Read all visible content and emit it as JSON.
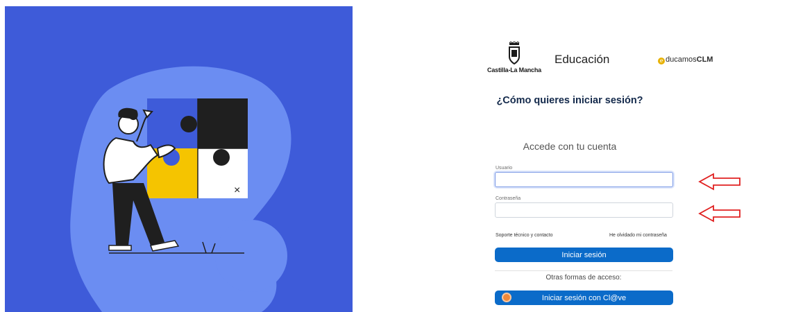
{
  "branding": {
    "region_logo_text": "Castilla-La Mancha",
    "department": "Educación",
    "educamos_prefix": "ducamos",
    "educamos_suffix": "CLM",
    "educamos_mark": "e"
  },
  "login": {
    "headline": "¿Cómo quieres iniciar sesión?",
    "subhead": "Accede con tu cuenta",
    "username": {
      "label": "Usuario",
      "value": "",
      "placeholder": ""
    },
    "password": {
      "label": "Contraseña",
      "value": "",
      "placeholder": ""
    },
    "support_link": "Soporte técnico y contacto",
    "forgot_link": "He olvidado mi contraseña",
    "submit_label": "Iniciar sesión",
    "other_methods_label": "Otras formas de acceso:",
    "clave_button_label": "Iniciar sesión con Cl@ve"
  },
  "colors": {
    "hero_background": "#3e5bd9",
    "hero_blob": "#6b8df2",
    "primary_button": "#0b6bc9",
    "annotation_arrow": "#e02020",
    "puzzle_yellow": "#f5c400"
  },
  "icons": {
    "x_mark": "×",
    "clave_icon": "cl@ve-icon"
  }
}
